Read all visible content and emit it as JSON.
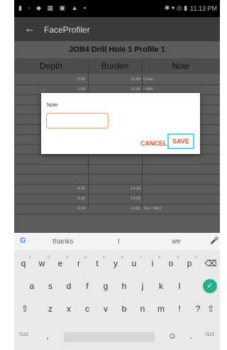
{
  "status_bar": {
    "left_icons": "▮ ▫ ◆ ▦ ▣ ▲ ▪",
    "right_icons": "✱ ▾ ◎ ▮",
    "time": "11:13 PM"
  },
  "app_bar": {
    "back_icon": "arrow-left",
    "title": "FaceProfiler"
  },
  "job_title": "JOB4 Drill Hole 1  Profile 1",
  "table": {
    "columns": [
      "Depth",
      "Burden",
      "Note"
    ],
    "rows": [
      {
        "depth": "0.00",
        "burden": "10.00",
        "note": "Crest"
      },
      {
        "depth": "1.00",
        "burden": "10.00",
        "note": "• MIN"
      },
      {
        "depth": "",
        "burden": "",
        "note": ""
      },
      {
        "depth": "",
        "burden": "",
        "note": ""
      },
      {
        "depth": "",
        "burden": "",
        "note": ""
      },
      {
        "depth": "",
        "burden": "",
        "note": ""
      },
      {
        "depth": "",
        "burden": "",
        "note": ""
      },
      {
        "depth": "",
        "burden": "",
        "note": ""
      },
      {
        "depth": "",
        "burden": "",
        "note": ""
      },
      {
        "depth": "",
        "burden": "",
        "note": ""
      },
      {
        "depth": "",
        "burden": "",
        "note": ""
      },
      {
        "depth": "8.00",
        "burden": "14.34",
        "note": ""
      },
      {
        "depth": "9.00",
        "burden": "14.58",
        "note": ""
      },
      {
        "depth": "9.44",
        "burden": "14.81",
        "note": "Toe • MAX"
      }
    ]
  },
  "dialog": {
    "label": "Note:",
    "value": "",
    "cancel": "CANCEL",
    "save": "SAVE"
  },
  "keyboard": {
    "suggestions": [
      "thanks",
      "I",
      "we"
    ],
    "row1": [
      "q",
      "w",
      "e",
      "r",
      "t",
      "y",
      "u",
      "i",
      "o",
      "p"
    ],
    "row1_nums": [
      "1",
      "2",
      "3",
      "4",
      "5",
      "6",
      "7",
      "8",
      "9",
      "0"
    ],
    "row2": [
      "a",
      "s",
      "d",
      "f",
      "g",
      "h",
      "j",
      "k",
      "l"
    ],
    "row3": [
      "z",
      "x",
      "c",
      "v",
      "b",
      "n",
      "m",
      "!",
      "?"
    ],
    "symbols_label": "?123",
    "comma": ",",
    "period": "."
  },
  "colors": {
    "accent": "#e05030",
    "save_highlight": "#4fd6e8",
    "field_border": "#e0a05a",
    "enter_key": "#27ae8a"
  }
}
